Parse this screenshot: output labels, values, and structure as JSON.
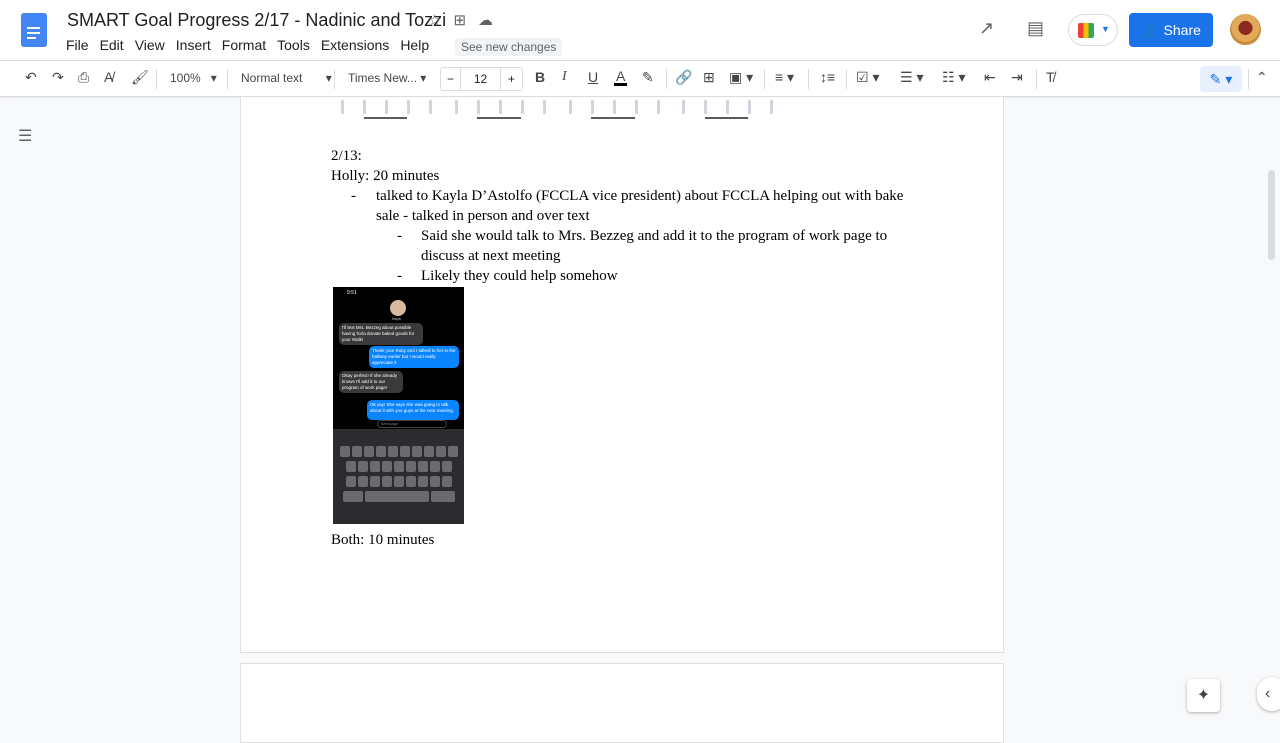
{
  "doc_title": "SMART Goal Progress 2/17 - Nadinic and Tozzi",
  "menu": [
    "File",
    "Edit",
    "View",
    "Insert",
    "Format",
    "Tools",
    "Extensions",
    "Help"
  ],
  "see_new_changes": "See new changes",
  "share_label": "Share",
  "toolbar": {
    "zoom": "100%",
    "style": "Normal text",
    "font": "Times New...",
    "font_size": "12",
    "bold": "B",
    "italic": "I",
    "underline": "U",
    "text_color": "A"
  },
  "colors": {
    "accent": "#1a73e8",
    "docs_blue": "#4285f4"
  },
  "content": {
    "date": "2/13:",
    "holly": "Holly: 20 minutes",
    "bullet1_line1": "talked to Kayla D’Astolfo (FCCLA vice president) about FCCLA helping out with bake",
    "bullet1_line2": "sale - talked in person and over text",
    "sub1_line1": "Said she would talk to Mrs. Bezzeg and add it to the program of work page to",
    "sub1_line2": "discuss at next meeting",
    "sub2": "Likely they could help somehow",
    "both": "Both: 10 minutes",
    "dash": "-"
  },
  "phone": {
    "time": "9:51",
    "contact": "Kayla",
    "messages": [
      "I'll text Mrs. Bezzeg about possible having fccla donate baked goods for your Walk!",
      "Thank you! Ruby and I talked to her in the hallway earlier but I would really appreciate it",
      "Okay perfect! If she already knows I'll add it to our program of work page!",
      "Ok yay! She says she was going to talk about it with you guys at the next meeting"
    ],
    "input_placeholder": "iMessage"
  }
}
